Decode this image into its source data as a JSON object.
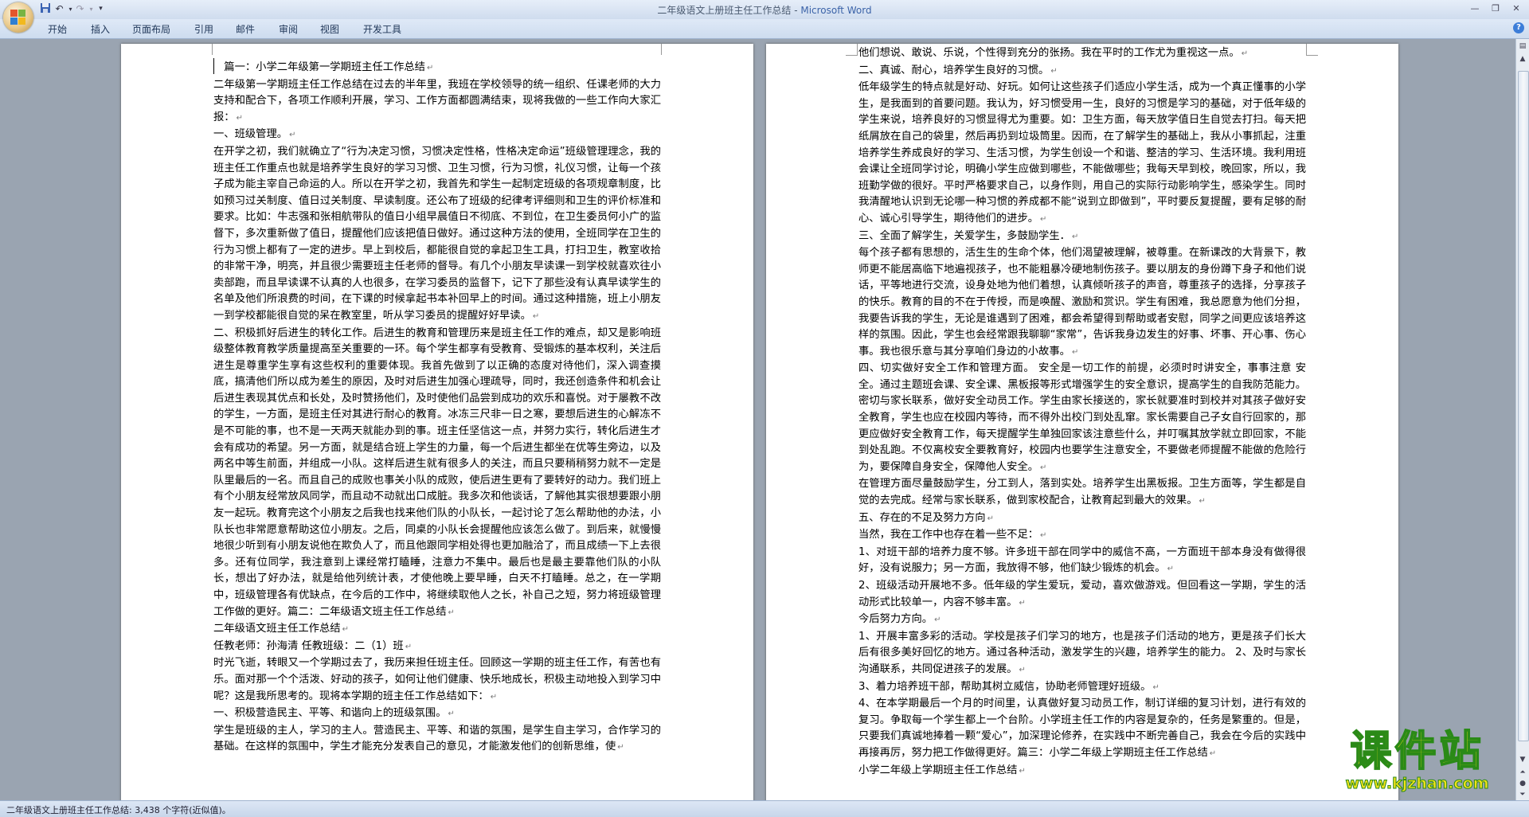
{
  "window": {
    "title": "二年级语文上册班主任工作总结",
    "title_sep": " - ",
    "app_name": "Microsoft Word"
  },
  "quick_access": {
    "save_icon": "save-icon",
    "undo_icon": "undo-icon",
    "redo_icon": "redo-icon",
    "customize_icon": "dropdown-icon"
  },
  "ribbon": {
    "tabs": [
      "开始",
      "插入",
      "页面布局",
      "引用",
      "邮件",
      "审阅",
      "视图",
      "开发工具"
    ]
  },
  "document": {
    "left_page": [
      "　篇一：小学二年级第一学期班主任工作总结",
      "二年级第一学期班主任工作总结在过去的半年里，我班在学校领导的统一组织、任课老师的大力支持和配合下，各项工作顺利开展，学习、工作方面都圆满结束，现将我做的一些工作向大家汇报：",
      "一、班级管理。",
      "在开学之初，我们就确立了“行为决定习惯，习惯决定性格，性格决定命运”班级管理理念，我的班主任工作重点也就是培养学生良好的学习习惯、卫生习惯，行为习惯，礼仪习惯，让每一个孩子成为能主宰自己命运的人。所以在开学之初，我首先和学生一起制定班级的各项规章制度，比如预习过关制度、值日过关制度、早读制度。还公布了班级的纪律考评细则和卫生的评价标准和要求。比如：牛志强和张相航带队的值日小组早晨值日不彻底、不到位，在卫生委员何小广的监督下，多次重新做了值日，提醒他们应该把值日做好。通过这种方法的使用，全班同学在卫生的行为习惯上都有了一定的进步。早上到校后，都能很自觉的拿起卫生工具，打扫卫生，教室收拾的非常干净，明亮，并且很少需要班主任老师的督导。有几个小朋友早读课一到学校就喜欢往小卖部跑，而且早读课不认真的人也很多，在学习委员的监督下，记下了那些没有认真早读学生的名单及他们所浪费的时间，在下课的时候拿起书本补回早上的时间。通过这种措施，班上小朋友一到学校都能很自觉的呆在教室里，听从学习委员的提醒好好早读。",
      "二、积极抓好后进生的转化工作。后进生的教育和管理历来是班主任工作的难点，却又是影响班级整体教育教学质量提高至关重要的一环。每个学生都享有受教育、受锻炼的基本权利，关注后进生是尊重学生享有这些权利的重要体现。我首先做到了以正确的态度对待他们，深入调查摸底，搞清他们所以成为差生的原因，及时对后进生加强心理疏导，同时，我还创造条件和机会让后进生表现其优点和长处，及时赞扬他们，及时使他们品尝到成功的欢乐和喜悦。对于屡教不改的学生，一方面，是班主任对其进行耐心的教育。冰冻三尺非一日之寒，要想后进生的心解冻不是不可能的事，也不是一天两天就能办到的事。班主任坚信这一点，并努力实行，转化后进生才会有成功的希望。另一方面，就是结合班上学生的力量，每一个后进生都坐在优等生旁边，以及两名中等生前面，并组成一小队。这样后进生就有很多人的关注，而且只要稍稍努力就不一定是队里最后的一名。而且自己的成败也事关小队的成败，使后进生更有了要转好的动力。我们班上有个小朋友经常放风同学，而且动不动就出口成脏。我多次和他谈话，了解他其实很想要跟小朋友一起玩。教育完这个小朋友之后我也找来他们队的小队长，一起讨论了怎么帮助他的办法，小队长也非常愿意帮助这位小朋友。之后，同桌的小队长会提醒他应该怎么做了。到后来，就慢慢地很少听到有小朋友说他在欺负人了，而且他跟同学相处得也更加融洽了，而且成绩一下上去很多。还有位同学，我注意到上课经常打瞌睡，注意力不集中。最后也是最主要靠他们队的小队长，想出了好办法，就是给他列统计表，才使他晚上要早睡，白天不打瞌睡。总之，在一学期中，班级管理各有优缺点，在今后的工作中，将继续取他人之长，补自己之短，努力将班级管理工作做的更好。篇二：二年级语文班主任工作总结",
      "二年级语文班主任工作总结",
      "任教老师：孙海清 任教班级：二（1）班",
      "时光飞逝，转眼又一个学期过去了，我历来担任班主任。回顾这一学期的班主任工作，有苦也有乐。面对那一个个活泼、好动的孩子，如何让他们健康、快乐地成长，积极主动地投入到学习中呢？这是我所思考的。现将本学期的班主任工作总结如下：",
      "一、积极营造民主、平等、和谐向上的班级氛围。",
      "学生是班级的主人，学习的主人。营造民主、平等、和谐的氛围，是学生自主学习，合作学习的基础。在这样的氛围中，学生才能充分发表自己的意见，才能激发他们的创新思维，使"
    ],
    "right_page": [
      "他们想说、敢说、乐说，个性得到充分的张扬。我在平时的工作尤为重视这一点。",
      "二、真诚、耐心，培养学生良好的习惯。",
      "低年级学生的特点就是好动、好玩。如何让这些孩子们适应小学生活，成为一个真正懂事的小学生，是我面到的首要问题。我认为，好习惯受用一生，良好的习惯是学习的基础，对于低年级的学生来说，培养良好的习惯显得尤为重要。如：卫生方面，每天放学值日生自觉去打扫。每天把纸屑放在自己的袋里，然后再扔到垃圾筒里。因而，在了解学生的基础上，我从小事抓起，注重培养学生养成良好的学习、生活习惯，为学生创设一个和谐、整洁的学习、生活环境。我利用班会课让全班同学讨论，明确小学生应做到哪些，不能做哪些；我每天早到校，晚回家，所以，我班勤学做的很好。平时严格要求自己，以身作则，用自己的实际行动影响学生，感染学生。同时我清醒地认识到无论哪一种习惯的养成都不能“说到立即做到”，平时要反复提醒，要有足够的耐心、诚心引导学生，期待他们的进步。",
      "三、全面了解学生，关爱学生，多鼓励学生．",
      "每个孩子都有思想的，活生生的生命个体，他们渴望被理解，被尊重。在新课改的大背景下，教师更不能居高临下地遍视孩子，也不能粗暴冷硬地制伤孩子。要以朋友的身份蹲下身子和他们说话，平等地进行交流，设身处地为他们着想，认真倾听孩子的声音，尊重孩子的选择，分享孩子的快乐。教育的目的不在于传授，而是唤醒、激励和赏识。学生有困难，我总愿意为他们分担，我要告诉我的学生，无论是谁遇到了困难，都会希望得到帮助或者安慰，同学之间更应该培养这样的氛围。因此，学生也会经常跟我聊聊“家常”，告诉我身边发生的好事、坏事、开心事、伤心事。我也很乐意与其分享咱们身边的小故事。",
      "四、切实做好安全工作和管理方面。 安全是一切工作的前提，必须时时讲安全，事事注意 安全。通过主题班会课、安全课、黑板报等形式增强学生的安全意识，提高学生的自我防范能力。密切与家长联系，做好安全动员工作。学生由家长接送的，家长就要准时到校并对其孩子做好安全教育，学生也应在校园内等待，而不得外出校门到处乱窜。家长需要自己子女自行回家的，那更应做好安全教育工作，每天提醒学生单独回家该注意些什么，并叮嘱其放学就立即回家，不能到处乱跑。不仅离校安全要教育好，校园内也要学生注意安全，不要做老师提醒不能做的危险行为，要保障自身安全，保障他人安全。",
      "在管理方面尽量鼓励学生，分工到人，落到实处。培养学生出黑板报。卫生方面等，学生都是自觉的去完成。经常与家长联系，做到家校配合，让教育起到最大的效果。",
      "五、存在的不足及努力方向",
      "当然，我在工作中也存在着一些不足：",
      "1、对班干部的培养力度不够。许多班干部在同学中的威信不高，一方面班干部本身没有做得很好，没有说服力；另一方面，我放得不够，他们缺少锻炼的机会。",
      "2、班级活动开展地不多。低年级的学生爱玩，爱动，喜欢做游戏。但回看这一学期，学生的活动形式比较单一，内容不够丰富。",
      "今后努力方向。",
      "1、开展丰富多彩的活动。学校是孩子们学习的地方，也是孩子们活动的地方，更是孩子们长大后有很多美好回忆的地方。通过各种活动，激发学生的兴趣，培养学生的能力。 2、及时与家长沟通联系，共同促进孩子的发展。",
      "3、着力培养班干部，帮助其树立威信，协助老师管理好班级。",
      "4、在本学期最后一个月的时间里，认真做好复习动员工作，制订详细的复习计划，进行有效的复习。争取每一个学生都上一个台阶。小学班主任工作的内容是复杂的，任务是繁重的。但是，只要我们真诚地捧着一颗“爱心”，加深理论修养，在实践中不断完善自己，我会在今后的实践中再接再厉，努力把工作做得更好。篇三：小学二年级上学期班主任工作总结",
      "小学二年级上学期班主任工作总结"
    ]
  },
  "statusbar": {
    "text": "二年级语文上册班主任工作总结: 3,438 个字符(近似值)。"
  },
  "watermark": {
    "title": "课件站",
    "url": "www.kjzhan.com"
  },
  "colors": {
    "ribbon_bg": "#d5e1f2",
    "workspace_bg": "#9aa4b1",
    "watermark_fill": "#f3e21a",
    "watermark_stroke": "#2a8a17"
  }
}
